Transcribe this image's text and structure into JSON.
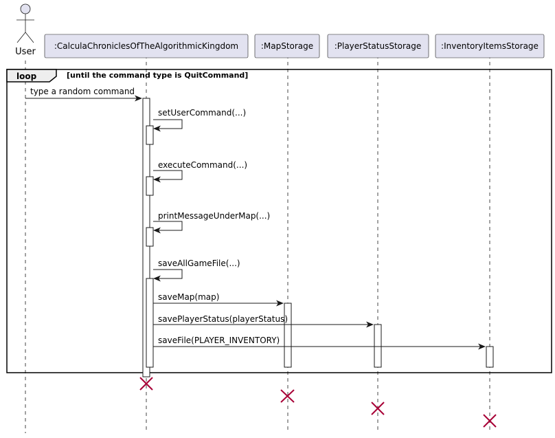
{
  "actor": {
    "label": "User"
  },
  "participants": [
    {
      "label": ":CalculaChroniclesOfTheAlgorithmicKingdom"
    },
    {
      "label": ":MapStorage"
    },
    {
      "label": ":PlayerStatusStorage"
    },
    {
      "label": ":InventoryItemsStorage"
    }
  ],
  "loop": {
    "label": "loop",
    "guard": "[until the command type is QuitCommand]"
  },
  "messages": [
    {
      "label": "type a random command"
    },
    {
      "label": "setUserCommand(...)"
    },
    {
      "label": "executeCommand(...)"
    },
    {
      "label": "printMessageUnderMap(...)"
    },
    {
      "label": "saveAllGameFile(...)"
    },
    {
      "label": "saveMap(map)"
    },
    {
      "label": "savePlayerStatus(playerStatus)"
    },
    {
      "label": "saveFile(PLAYER_INVENTORY)"
    }
  ],
  "colors": {
    "participant_fill": "#e2e2f0",
    "destroy_mark": "#a80036",
    "loop_tab": "#eeeeee"
  }
}
